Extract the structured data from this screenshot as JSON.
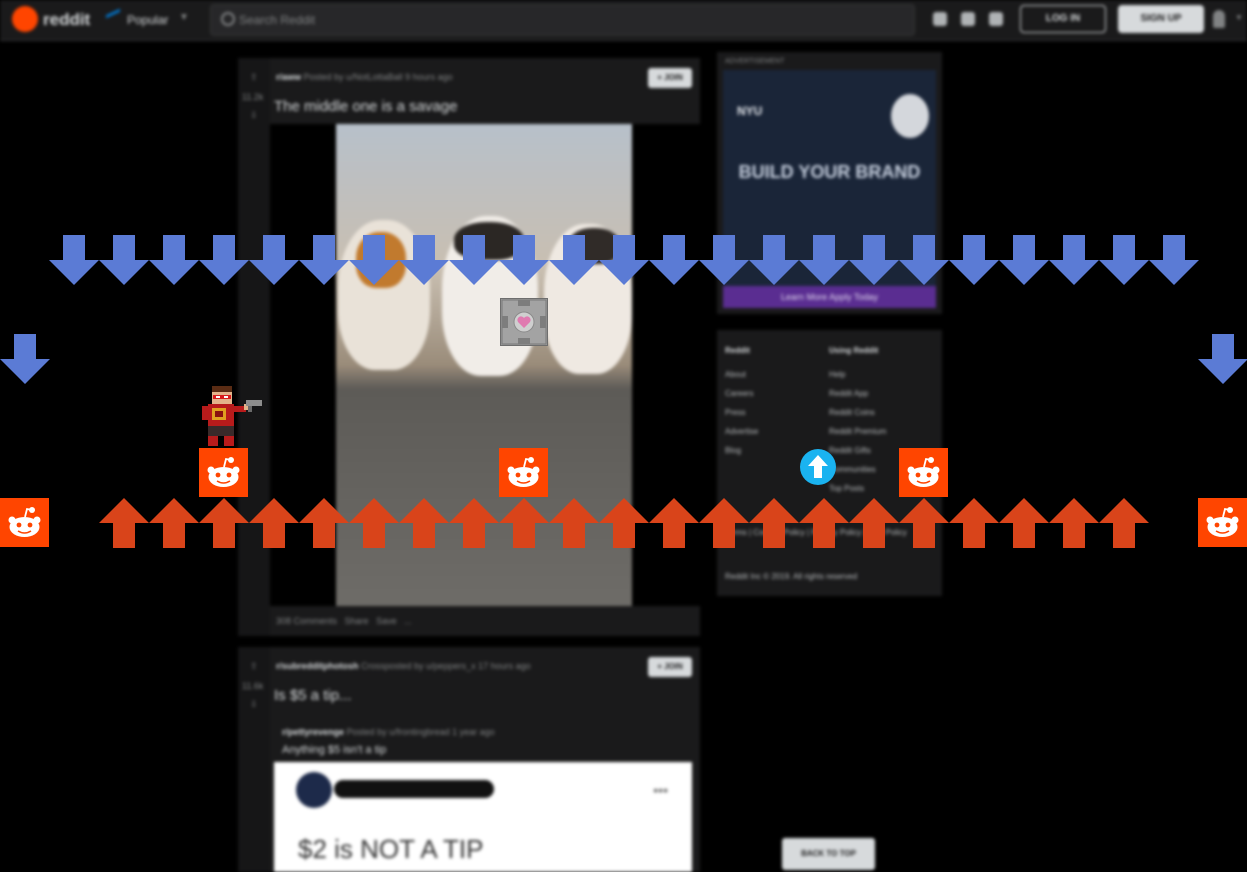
{
  "header": {
    "logo_text": "reddit",
    "feed_label": "Popular",
    "search_placeholder": "Search Reddit",
    "login_label": "LOG IN",
    "signup_label": "SIGN UP"
  },
  "posts": [
    {
      "votes": "11.2k",
      "subreddit": "r/aww",
      "posted_by": "Posted by u/NotLottaBall 9 hours ago",
      "join_label": "+ JOIN",
      "title": "The middle one is a savage",
      "comments": "308 Comments",
      "share": "Share",
      "save": "Save",
      "more": "..."
    },
    {
      "votes": "11.6k",
      "subreddit": "r/subredditphotosh",
      "posted_by": "Crossposted by u/peppers_x 17 hours ago",
      "join_label": "+ JOIN",
      "title": "Is $5 a tip...",
      "crosspost_sub": "r/pettyrevenge",
      "crosspost_by": "Posted by u/frontingbread 1 year ago",
      "crosspost_title": "Anything $5 isn't a tip",
      "tweet_text": "$2 is NOT A TIP"
    }
  ],
  "ad": {
    "label": "ADVERTISEMENT",
    "brand": "NYU",
    "headline": "BUILD YOUR BRAND",
    "cta": "Learn More Apply Today"
  },
  "footer": {
    "col1_head": "Reddit",
    "col1": [
      "About",
      "Careers",
      "Press",
      "Advertise",
      "Blog"
    ],
    "col2_head": "Using Reddit",
    "col2": [
      "Help",
      "Reddit App",
      "Reddit Coins",
      "Reddit Premium",
      "Reddit Gifts",
      "Communities",
      "Top Posts"
    ],
    "legal": "Terms | Content Policy | Privacy Policy | Mod Policy",
    "copyright": "Reddit Inc © 2019. All rights reserved",
    "back_to_top": "BACK TO TOP"
  },
  "game": {
    "down_arrow_color": "#5b7bd5",
    "up_arrow_color": "#d9441a",
    "tile_color": "#ff4500",
    "orb_color": "#1ab3f0",
    "cube_heart_color": "#e07ab0",
    "down_arrow_count": 23,
    "up_arrow_count": 21,
    "edge_down_arrows": 2,
    "reddit_tiles": 5,
    "player": "pixel-gunman",
    "collectible": "companion-cube",
    "powerup": "up-arrow-orb"
  }
}
